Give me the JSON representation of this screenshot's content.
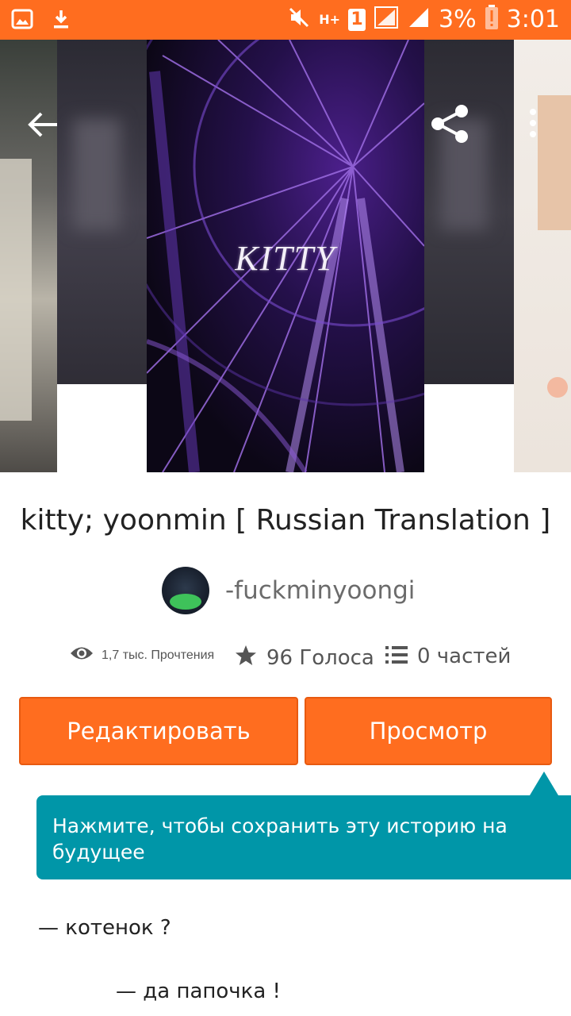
{
  "status_bar": {
    "battery_percent": "3%",
    "time": "3:01",
    "sim_slot": "1",
    "network_label": "H+",
    "icons": [
      "gallery-icon",
      "download-icon",
      "mute-icon",
      "data-icon",
      "sim-icon",
      "signal-icon",
      "signal-icon",
      "battery-alert-icon"
    ]
  },
  "header": {
    "icons": [
      "back-arrow-icon",
      "share-icon",
      "more-vert-icon"
    ]
  },
  "cover": {
    "title": "KITTY"
  },
  "story": {
    "title": "kitty; yoonmin [ Russian Translation ]",
    "author": "-fuckminyoongi"
  },
  "stats": {
    "reads": "1,7 тыс. Прочтения",
    "votes": "96 Голоса",
    "parts": "0 частей",
    "icons": [
      "eye-icon",
      "star-icon",
      "list-icon"
    ]
  },
  "buttons": {
    "edit": "Редактировать",
    "view": "Просмотр"
  },
  "tooltip": {
    "text": "Нажмите, чтобы сохранить эту историю на будущее"
  },
  "content": {
    "line1": "— котенок ?",
    "line2": "— да папочка !"
  },
  "colors": {
    "accent": "#ff6d1f",
    "tooltip": "#0096a8"
  }
}
